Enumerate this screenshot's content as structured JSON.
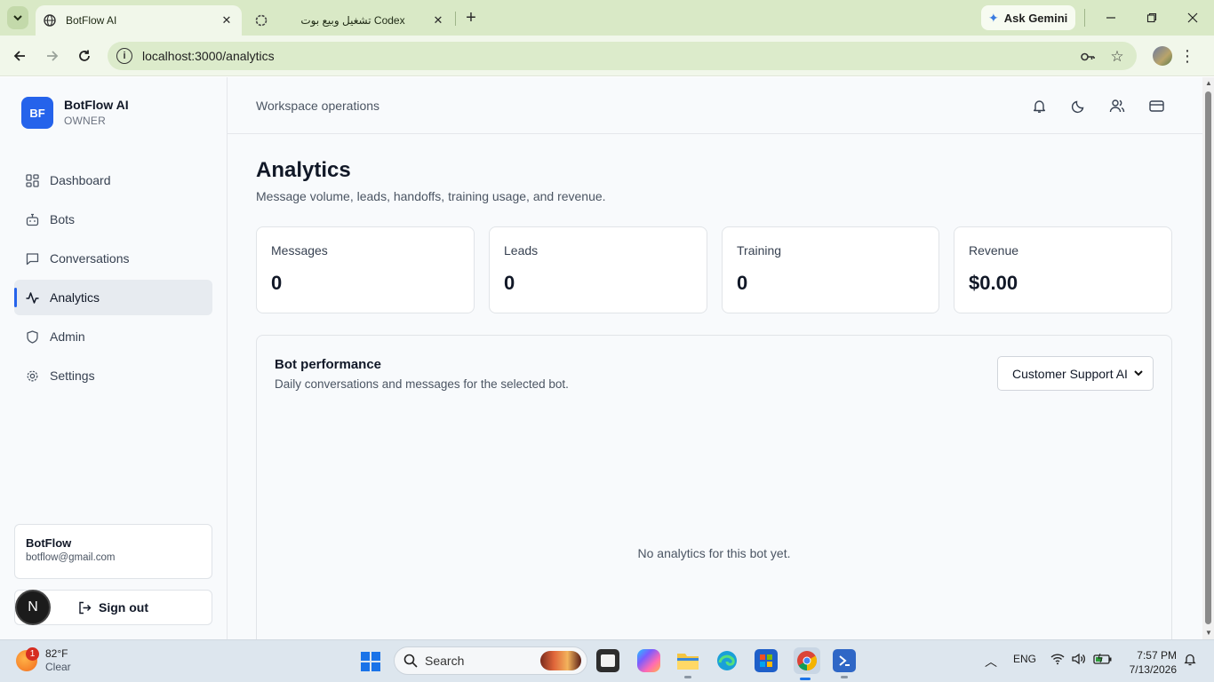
{
  "browser": {
    "tabs": [
      {
        "title": "BotFlow AI",
        "active": true
      },
      {
        "title": "تشغيل وبيع بوت Codex",
        "active": false
      }
    ],
    "ask_gemini": "Ask Gemini",
    "url": "localhost:3000/analytics"
  },
  "sidebar": {
    "brand_logo": "BF",
    "brand_name": "BotFlow AI",
    "brand_role": "OWNER",
    "items": [
      {
        "label": "Dashboard",
        "icon": "grid-icon"
      },
      {
        "label": "Bots",
        "icon": "bot-icon"
      },
      {
        "label": "Conversations",
        "icon": "message-icon"
      },
      {
        "label": "Analytics",
        "icon": "activity-icon",
        "active": true
      },
      {
        "label": "Admin",
        "icon": "shield-icon"
      },
      {
        "label": "Settings",
        "icon": "gear-icon"
      }
    ],
    "user": {
      "name": "BotFlow",
      "email": "botflow@gmail.com"
    },
    "signout_label": "Sign out",
    "avatar_letter": "N"
  },
  "topbar": {
    "breadcrumb": "Workspace operations",
    "icons": [
      "bell-icon",
      "moon-icon",
      "users-icon",
      "card-icon"
    ]
  },
  "page": {
    "title": "Analytics",
    "subtitle": "Message volume, leads, handoffs, training usage, and revenue.",
    "stats": [
      {
        "label": "Messages",
        "value": "0"
      },
      {
        "label": "Leads",
        "value": "0"
      },
      {
        "label": "Training",
        "value": "0"
      },
      {
        "label": "Revenue",
        "value": "$0.00"
      }
    ],
    "performance": {
      "title": "Bot performance",
      "subtitle": "Daily conversations and messages for the selected bot.",
      "selected_bot": "Customer Support AI",
      "empty": "No analytics for this bot yet."
    }
  },
  "taskbar": {
    "weather_temp": "82°F",
    "weather_desc": "Clear",
    "weather_badge": "1",
    "search_label": "Search",
    "language": "ENG",
    "time": "7:57 PM",
    "date": "7/13/2026"
  },
  "colors": {
    "accent": "#2563eb",
    "chrome_frame": "#d9e9c6",
    "chrome_toolbar": "#f1f7ea"
  }
}
